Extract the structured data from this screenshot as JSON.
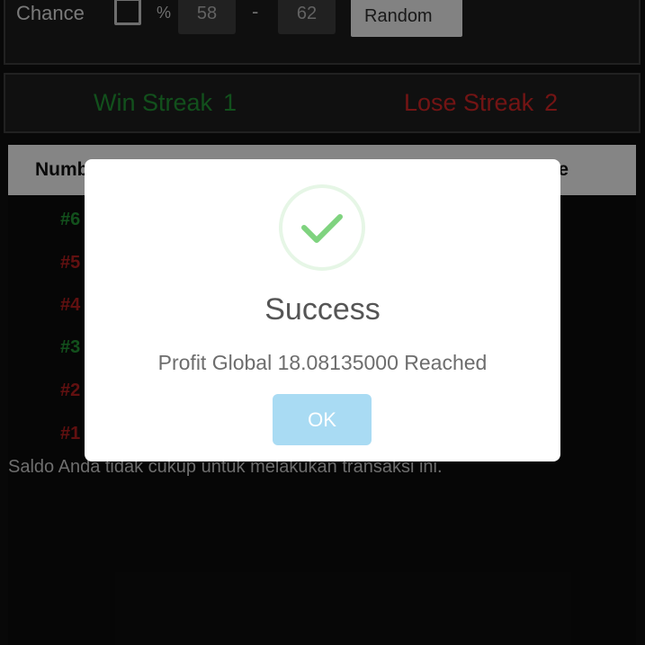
{
  "chance": {
    "label": "Chance",
    "percent_symbol": "%",
    "min_value": "58",
    "separator": "-",
    "max_value": "62",
    "random_label": "Random"
  },
  "streaks": {
    "win_label": "Win Streak",
    "win_value": "1",
    "lose_label": "Lose Streak",
    "lose_value": "2"
  },
  "table": {
    "header_number": "Numb",
    "header_right_fragment": "e",
    "rows": [
      {
        "id": "#6",
        "result": "win"
      },
      {
        "id": "#5",
        "result": "lose"
      },
      {
        "id": "#4",
        "result": "lose"
      },
      {
        "id": "#3",
        "result": "win"
      },
      {
        "id": "#2",
        "result": "lose"
      },
      {
        "id": "#1",
        "result": "lose"
      }
    ]
  },
  "balance_message": "Saldo Anda tidak cukup untuk melakukan transaksi ini.",
  "dialog": {
    "icon": "check-circle-icon",
    "title": "Success",
    "message": "Profit Global 18.08135000 Reached",
    "ok_label": "OK"
  },
  "colors": {
    "win": "#1f8a31",
    "lose": "#c62424",
    "ok_button": "#a9dbf3",
    "check": "#7fd37f"
  }
}
